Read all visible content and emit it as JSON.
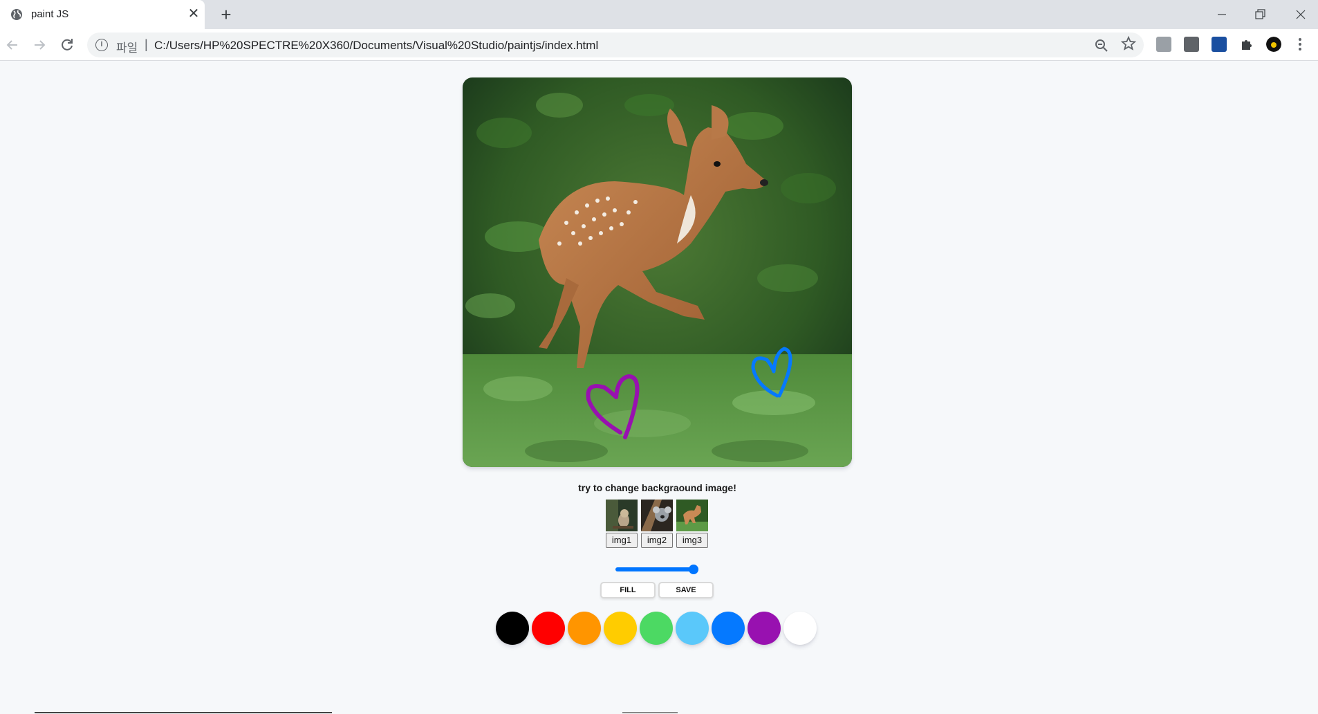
{
  "browser": {
    "tab_title": "paint JS",
    "tab_close": "✕",
    "new_tab": "+",
    "scheme_label": "파일",
    "separator": "|",
    "url": "C:/Users/HP%20SPECTRE%20X360/Documents/Visual%20Studio/paintjs/index.html",
    "info_glyph": "i",
    "icons": [
      "globe-icon",
      "back-arrow-icon",
      "forward-arrow-icon",
      "reload-icon",
      "info-icon",
      "zoom-out-icon",
      "star-icon",
      "puzzle-icon",
      "kebab-menu-icon",
      "minimize-icon",
      "restore-icon",
      "close-window-icon"
    ]
  },
  "page": {
    "hint": "try to change backgraound image!",
    "thumbs": [
      {
        "label": "img1",
        "icon": "owl-thumbnail"
      },
      {
        "label": "img2",
        "icon": "koala-thumbnail"
      },
      {
        "label": "img3",
        "icon": "deer-thumbnail"
      }
    ],
    "brush_range": {
      "min": 0.1,
      "max": 5,
      "value": 5
    },
    "fill_label": "Fill",
    "save_label": "Save",
    "colors": [
      "#000000",
      "#ff0000",
      "#ff9500",
      "#ffcc00",
      "#4cd963",
      "#5ac8fa",
      "#0579ff",
      "#9811b0",
      "#ffffff"
    ],
    "drawing": {
      "background": "deer-photo",
      "strokes": [
        {
          "shape": "heart",
          "color": "#9811b0"
        },
        {
          "shape": "heart",
          "color": "#0579ff"
        }
      ]
    }
  }
}
